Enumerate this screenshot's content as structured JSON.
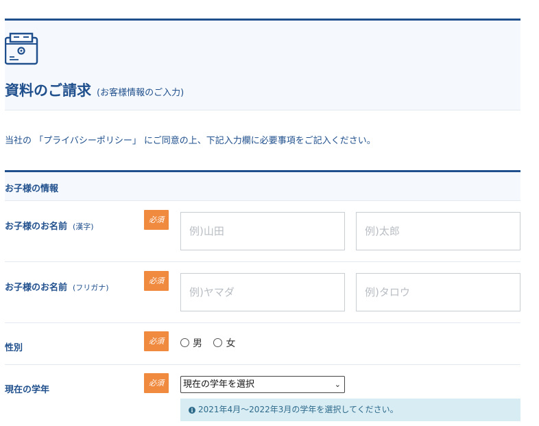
{
  "header": {
    "icon": "document-request-icon",
    "title": "資料のご請求",
    "subtitle": "(お客様情報のご入力)"
  },
  "intro": "当社の 「プライバシーポリシー」 にご同意の上、下記入力欄に必要事項をご記入ください。",
  "section": {
    "title": "お子様の情報"
  },
  "required_label": "必須",
  "rows": {
    "name_kanji": {
      "label": "お子様のお名前",
      "note": "(漢字)",
      "last_placeholder": "例)山田",
      "first_placeholder": "例)太郎"
    },
    "name_kana": {
      "label": "お子様のお名前",
      "note": "(フリガナ)",
      "last_placeholder": "例)ヤマダ",
      "first_placeholder": "例)タロウ"
    },
    "gender": {
      "label": "性別",
      "option_male": "男",
      "option_female": "女"
    },
    "grade": {
      "label": "現在の学年",
      "selected": "現在の学年を選択",
      "info": "2021年4月〜2022年3月の学年を選択してください。"
    }
  },
  "colors": {
    "brand": "#1f4f8c",
    "required": "#ef8a3f",
    "info_bg": "#d8ecf4"
  }
}
